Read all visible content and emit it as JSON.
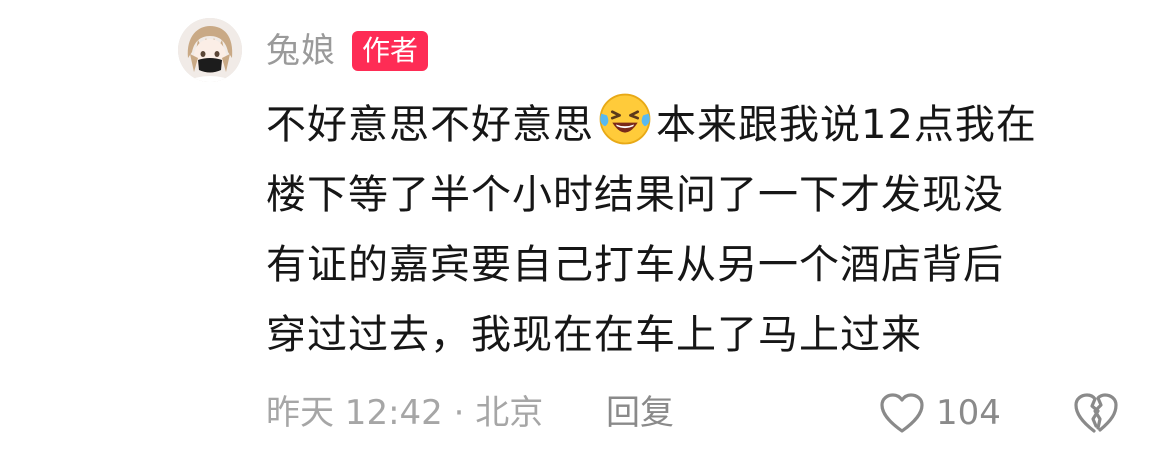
{
  "comment": {
    "username": "兔娘",
    "author_badge": "作者",
    "text_lines": [
      {
        "before": "不好意思不好意思",
        "emoji": "laughing-tears-emoji",
        "after": "本来跟我说12点我在"
      },
      {
        "text": "楼下等了半个小时结果问了一下才发现没"
      },
      {
        "text": "有证的嘉宾要自己打车从另一个酒店背后"
      },
      {
        "text": "穿过过去，我现在在车上了马上过来"
      }
    ],
    "meta": "昨天 12:42 · 北京",
    "reply_label": "回复",
    "like_count": "104"
  },
  "colors": {
    "badge": "#fe2c55",
    "text": "#161616",
    "muted": "#9a9a9a"
  }
}
